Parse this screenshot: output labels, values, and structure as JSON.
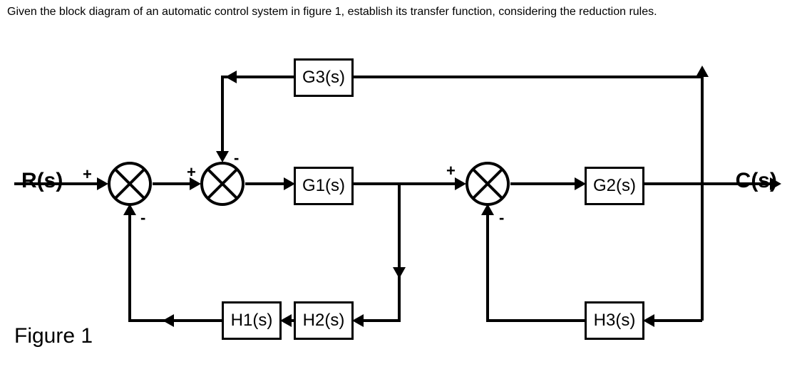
{
  "problem": {
    "text": "Given the block diagram of an automatic control system in figure 1, establish its transfer function, considering the reduction rules."
  },
  "labels": {
    "input": "R(s)",
    "output": "C(s)",
    "caption": "Figure 1"
  },
  "blocks": {
    "G1": "G1(s)",
    "G2": "G2(s)",
    "G3": "G3(s)",
    "H1": "H1(s)",
    "H2": "H2(s)",
    "H3": "H3(s)"
  },
  "signs": {
    "s1_left": "+",
    "s1_bottom": "-",
    "s2_left": "+",
    "s2_top": "-",
    "s3_left": "+",
    "s3_bottom": "-"
  },
  "chart_data": {
    "type": "block-diagram",
    "input": "R(s)",
    "output": "C(s)",
    "summing_junctions": [
      {
        "id": "S1",
        "inputs": [
          {
            "from": "R(s)",
            "sign": "+"
          },
          {
            "from": "H1(s)_out",
            "sign": "-"
          }
        ],
        "output_to": "S2"
      },
      {
        "id": "S2",
        "inputs": [
          {
            "from": "S1",
            "sign": "+"
          },
          {
            "from": "G3(s)_out",
            "sign": "-"
          }
        ],
        "output_to": "G1(s)"
      },
      {
        "id": "S3",
        "inputs": [
          {
            "from": "G1(s)_out",
            "sign": "+"
          },
          {
            "from": "H3(s)_out",
            "sign": "-"
          }
        ],
        "output_to": "G2(s)"
      }
    ],
    "blocks": [
      {
        "id": "G1(s)",
        "from": "S2",
        "to": [
          "S3",
          "H2(s)"
        ]
      },
      {
        "id": "G2(s)",
        "from": "S3",
        "to": [
          "C(s)"
        ]
      },
      {
        "id": "G3(s)",
        "from": "C(s)",
        "to": [
          "S2"
        ]
      },
      {
        "id": "H2(s)",
        "from": "G1(s)_out",
        "to": [
          "H1(s)"
        ]
      },
      {
        "id": "H1(s)",
        "from": "H2(s)_out",
        "to": [
          "S1"
        ]
      },
      {
        "id": "H3(s)",
        "from": "C(s)",
        "to": [
          "S3"
        ]
      }
    ],
    "signal_flow": [
      "R(s) -> S1(+)",
      "S1 -> S2(+)",
      "S2 -> G1(s)",
      "G1(s) -> node_A",
      "node_A -> S3(+)",
      "node_A -> H2(s)",
      "H2(s) -> H1(s)",
      "H1(s) -> S1(-)",
      "S3 -> G2(s)",
      "G2(s) -> node_B (= C(s))",
      "node_B -> G3(s)",
      "G3(s) -> S2(-)",
      "node_B -> H3(s)",
      "H3(s) -> S3(-)"
    ]
  }
}
